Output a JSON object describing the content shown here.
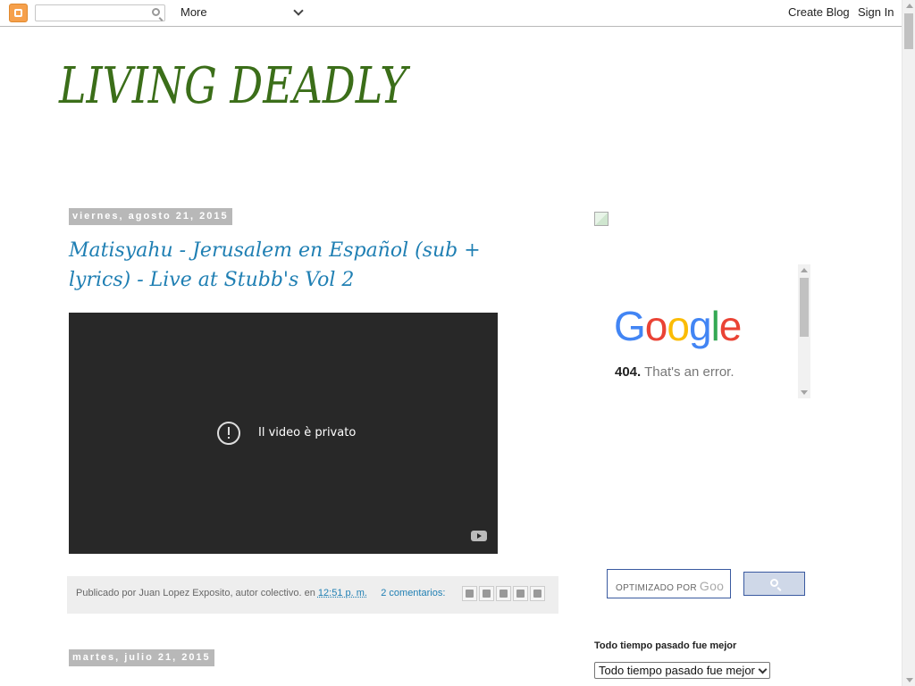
{
  "navbar": {
    "more_label": "More",
    "create_blog": "Create Blog",
    "sign_in": "Sign In"
  },
  "blog": {
    "title": "LIVING DEADLY"
  },
  "posts": [
    {
      "date": "viernes, agosto 21, 2015",
      "title": "Matisyahu - Jerusalem en Español (sub + lyrics) - Live at Stubb's Vol 2",
      "video_message": "Il video è privato",
      "footer": {
        "posted_by": "Publicado por Juan Lopez Exposito, autor colectivo. en",
        "time": "12:51 p. m.",
        "comments": "2 comentarios:"
      },
      "share_icons": [
        "email-icon",
        "blogger-icon",
        "twitter-icon",
        "facebook-icon",
        "pinterest-icon"
      ]
    },
    {
      "date": "martes, julio 21, 2015"
    }
  ],
  "sidebar": {
    "google_error": {
      "logo_letters": [
        "G",
        "o",
        "o",
        "g",
        "l",
        "e"
      ],
      "logo_colors": [
        "#4285F4",
        "#EA4335",
        "#FBBC05",
        "#4285F4",
        "#34A853",
        "#EA4335"
      ],
      "code": "404.",
      "message": "That's an error."
    },
    "search": {
      "placeholder": "OPTIMIZADO POR",
      "brand_fragment": "Goo"
    },
    "archive": {
      "title": "Todo tiempo pasado fue mejor",
      "selected": "Todo tiempo pasado fue mejor"
    }
  },
  "colors": {
    "title_green": "#3b6e19",
    "link_blue": "#1f7fb3",
    "date_bg": "#b8b8b8"
  }
}
